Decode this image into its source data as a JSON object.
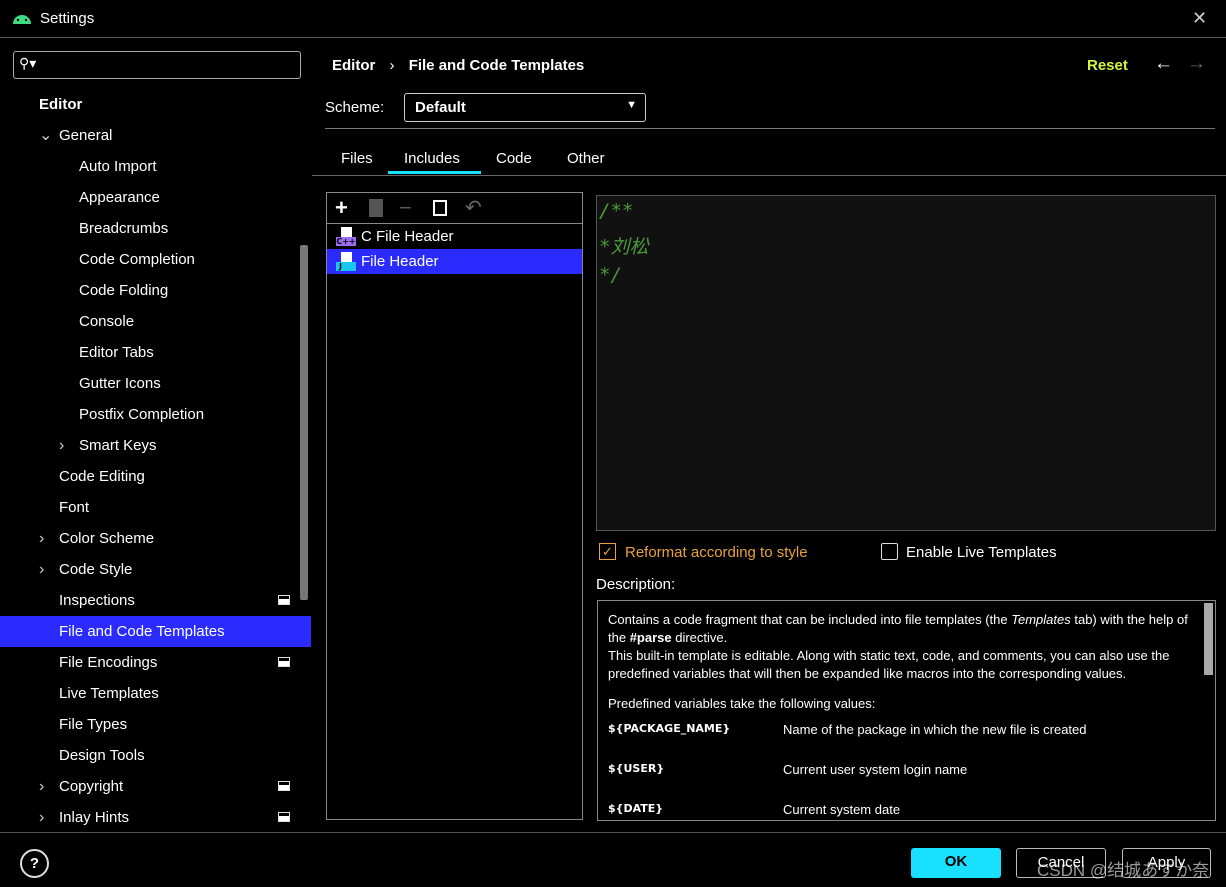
{
  "window": {
    "title": "Settings",
    "close": "✕"
  },
  "sidebar": {
    "search_placeholder": "",
    "items": [
      {
        "label": "Editor",
        "level": 0,
        "bold": true
      },
      {
        "label": "General",
        "level": 1,
        "expanded": true
      },
      {
        "label": "Auto Import",
        "level": 2
      },
      {
        "label": "Appearance",
        "level": 2
      },
      {
        "label": "Breadcrumbs",
        "level": 2
      },
      {
        "label": "Code Completion",
        "level": 2
      },
      {
        "label": "Code Folding",
        "level": 2
      },
      {
        "label": "Console",
        "level": 2
      },
      {
        "label": "Editor Tabs",
        "level": 2
      },
      {
        "label": "Gutter Icons",
        "level": 2
      },
      {
        "label": "Postfix Completion",
        "level": 2
      },
      {
        "label": "Smart Keys",
        "level": 2,
        "collapsed": true
      },
      {
        "label": "Code Editing",
        "level": 1
      },
      {
        "label": "Font",
        "level": 1
      },
      {
        "label": "Color Scheme",
        "level": 1,
        "collapsed": true
      },
      {
        "label": "Code Style",
        "level": 1,
        "collapsed": true
      },
      {
        "label": "Inspections",
        "level": 1,
        "marker": true
      },
      {
        "label": "File and Code Templates",
        "level": 1,
        "selected": true
      },
      {
        "label": "File Encodings",
        "level": 1,
        "marker": true
      },
      {
        "label": "Live Templates",
        "level": 1
      },
      {
        "label": "File Types",
        "level": 1
      },
      {
        "label": "Design Tools",
        "level": 1
      },
      {
        "label": "Copyright",
        "level": 1,
        "collapsed": true,
        "marker": true
      },
      {
        "label": "Inlay Hints",
        "level": 1,
        "collapsed": true,
        "marker": true
      }
    ]
  },
  "header": {
    "breadcrumb": [
      "Editor",
      "File and Code Templates"
    ],
    "sep": "›",
    "reset": "Reset",
    "back": "←",
    "forward": "→"
  },
  "scheme": {
    "label": "Scheme:",
    "value": "Default"
  },
  "tabs": [
    {
      "label": "Files"
    },
    {
      "label": "Includes",
      "active": true
    },
    {
      "label": "Code"
    },
    {
      "label": "Other"
    }
  ],
  "toolbar": {
    "add": "+",
    "remove": "−",
    "undo": "↶"
  },
  "templates": [
    {
      "label": "C File Header",
      "badge": "C++",
      "badge_color": "#9a6cf0"
    },
    {
      "label": "File Header",
      "badge": "J",
      "badge_color": "#18c8f0",
      "selected": true
    }
  ],
  "editor": {
    "lines": [
      "/**",
      "*刘松",
      "*/"
    ]
  },
  "options": {
    "reformat": {
      "label": "Reformat according to style",
      "checked": true
    },
    "live": {
      "label": "Enable Live Templates",
      "checked": false
    }
  },
  "description": {
    "label": "Description:",
    "p1a": "Contains a code fragment that can be included into file templates (the ",
    "p1b": "Templates",
    "p1c": " tab) with the help of the ",
    "p1d": "#parse",
    "p1e": " directive.",
    "p2": "This built-in template is editable. Along with static text, code, and comments, you can also use the predefined variables that will then be expanded like macros into the corresponding values.",
    "p3": "Predefined variables take the following values:",
    "vars": [
      {
        "name": "${PACKAGE_NAME}",
        "desc": "Name of the package in which the new file is created"
      },
      {
        "name": "${USER}",
        "desc": "Current user system login name"
      },
      {
        "name": "${DATE}",
        "desc": "Current system date"
      }
    ]
  },
  "footer": {
    "help": "?",
    "ok": "OK",
    "cancel": "Cancel",
    "apply": "Apply",
    "watermark": "CSDN @结城あすか奈"
  },
  "colors": {
    "accent": "#18e0ff",
    "selection": "#2b2bff",
    "reset": "#d4f542",
    "reformat": "#e8a23c",
    "comment": "#4a9a3a"
  }
}
